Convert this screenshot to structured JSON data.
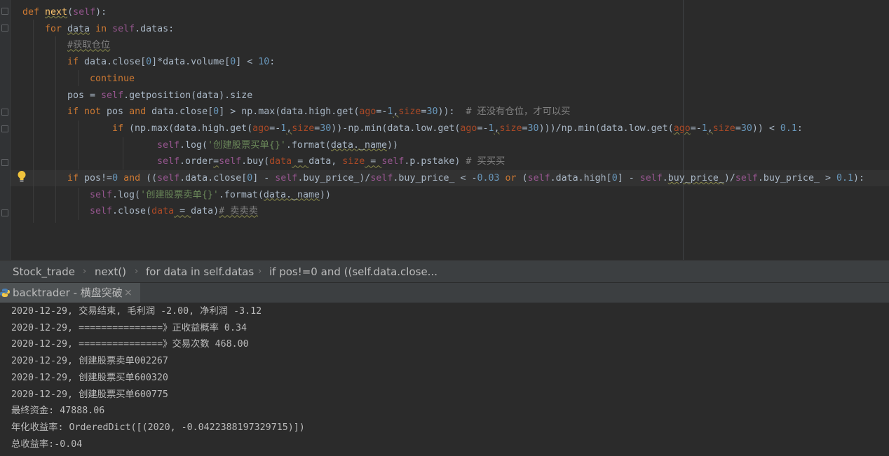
{
  "editor": {
    "lines": [
      {
        "indent": 0,
        "tokens": [
          {
            "t": "def ",
            "c": "kw"
          },
          {
            "t": "next",
            "c": "fn sq"
          },
          {
            "t": "(",
            "c": ""
          },
          {
            "t": "self",
            "c": "slf"
          },
          {
            "t": "):",
            "c": ""
          }
        ]
      },
      {
        "indent": 1,
        "tokens": [
          {
            "t": "for ",
            "c": "kw"
          },
          {
            "t": "data",
            "c": "sq"
          },
          {
            "t": " in ",
            "c": "kw"
          },
          {
            "t": "self",
            "c": "slf"
          },
          {
            "t": ".datas:",
            "c": ""
          }
        ]
      },
      {
        "indent": 2,
        "tokens": [
          {
            "t": "#获取仓位",
            "c": "cmt sq"
          }
        ]
      },
      {
        "indent": 2,
        "tokens": [
          {
            "t": "if ",
            "c": "kw"
          },
          {
            "t": "data.close[",
            "c": ""
          },
          {
            "t": "0",
            "c": "num"
          },
          {
            "t": "]*data.volume[",
            "c": ""
          },
          {
            "t": "0",
            "c": "num"
          },
          {
            "t": "] < ",
            "c": ""
          },
          {
            "t": "10",
            "c": "num"
          },
          {
            "t": ":",
            "c": ""
          }
        ]
      },
      {
        "indent": 3,
        "tokens": [
          {
            "t": "continue",
            "c": "kw"
          }
        ]
      },
      {
        "indent": 2,
        "tokens": [
          {
            "t": "pos = ",
            "c": ""
          },
          {
            "t": "self",
            "c": "slf"
          },
          {
            "t": ".getposition(data).size",
            "c": ""
          }
        ]
      },
      {
        "indent": 2,
        "tokens": [
          {
            "t": "if not ",
            "c": "kw"
          },
          {
            "t": "pos ",
            "c": ""
          },
          {
            "t": "and ",
            "c": "kw"
          },
          {
            "t": "data.close[",
            "c": ""
          },
          {
            "t": "0",
            "c": "num"
          },
          {
            "t": "] > np.max(data.high.get(",
            "c": ""
          },
          {
            "t": "ago",
            "c": "prm"
          },
          {
            "t": "=-",
            "c": ""
          },
          {
            "t": "1",
            "c": "num"
          },
          {
            "t": ",",
            "c": "sq"
          },
          {
            "t": "size",
            "c": "prm"
          },
          {
            "t": "=",
            "c": ""
          },
          {
            "t": "30",
            "c": "num"
          },
          {
            "t": ")):  ",
            "c": ""
          },
          {
            "t": "# 还没有仓位，才可以买",
            "c": "cmt"
          }
        ]
      },
      {
        "indent": 4,
        "tokens": [
          {
            "t": "if ",
            "c": "kw"
          },
          {
            "t": "(np.max(data.high.get(",
            "c": ""
          },
          {
            "t": "ago",
            "c": "prm"
          },
          {
            "t": "=-",
            "c": ""
          },
          {
            "t": "1",
            "c": "num"
          },
          {
            "t": ",",
            "c": "sq"
          },
          {
            "t": "size",
            "c": "prm"
          },
          {
            "t": "=",
            "c": ""
          },
          {
            "t": "30",
            "c": "num"
          },
          {
            "t": "))-np.min(data.low.get(",
            "c": ""
          },
          {
            "t": "ago",
            "c": "prm"
          },
          {
            "t": "=-",
            "c": ""
          },
          {
            "t": "1",
            "c": "num"
          },
          {
            "t": ",",
            "c": "sq"
          },
          {
            "t": "size",
            "c": "prm"
          },
          {
            "t": "=",
            "c": ""
          },
          {
            "t": "30",
            "c": "num"
          },
          {
            "t": ")))/np.min(data.low.get(",
            "c": ""
          },
          {
            "t": "ago",
            "c": "prm sq"
          },
          {
            "t": "=-",
            "c": ""
          },
          {
            "t": "1",
            "c": "num"
          },
          {
            "t": ",",
            "c": "sq"
          },
          {
            "t": "size",
            "c": "prm"
          },
          {
            "t": "=",
            "c": ""
          },
          {
            "t": "30",
            "c": "num"
          },
          {
            "t": ")) < ",
            "c": ""
          },
          {
            "t": "0.1",
            "c": "num"
          },
          {
            "t": ":",
            "c": ""
          }
        ]
      },
      {
        "indent": 6,
        "tokens": [
          {
            "t": "self",
            "c": "slf"
          },
          {
            "t": ".log(",
            "c": ""
          },
          {
            "t": "'创建股票买单{}'",
            "c": "str"
          },
          {
            "t": ".format(",
            "c": ""
          },
          {
            "t": "data._name",
            "c": "sq"
          },
          {
            "t": "))",
            "c": ""
          }
        ]
      },
      {
        "indent": 6,
        "tokens": [
          {
            "t": "self",
            "c": "slf"
          },
          {
            "t": ".order",
            "c": ""
          },
          {
            "t": "=",
            "c": "sq"
          },
          {
            "t": "self",
            "c": "slf"
          },
          {
            "t": ".buy(",
            "c": ""
          },
          {
            "t": "data",
            "c": "prm"
          },
          {
            "t": " = ",
            "c": "sq"
          },
          {
            "t": "data, ",
            "c": ""
          },
          {
            "t": "size",
            "c": "prm"
          },
          {
            "t": " = ",
            "c": "sq"
          },
          {
            "t": "self",
            "c": "slf"
          },
          {
            "t": ".p.pstake) ",
            "c": ""
          },
          {
            "t": "# 买买买",
            "c": "cmt"
          }
        ]
      },
      {
        "indent": 2,
        "tokens": [
          {
            "t": "if ",
            "c": "kw"
          },
          {
            "t": "pos!=",
            "c": ""
          },
          {
            "t": "0 ",
            "c": "num"
          },
          {
            "t": "and ",
            "c": "kw"
          },
          {
            "t": "((",
            "c": ""
          },
          {
            "t": "self",
            "c": "slf"
          },
          {
            "t": ".data.close[",
            "c": ""
          },
          {
            "t": "0",
            "c": "num"
          },
          {
            "t": "] - ",
            "c": ""
          },
          {
            "t": "self",
            "c": "slf"
          },
          {
            "t": ".buy_price_)/",
            "c": ""
          },
          {
            "t": "self",
            "c": "slf"
          },
          {
            "t": ".buy_price_ < -",
            "c": ""
          },
          {
            "t": "0.03 ",
            "c": "num"
          },
          {
            "t": "or ",
            "c": "kw"
          },
          {
            "t": "(",
            "c": ""
          },
          {
            "t": "self",
            "c": "slf"
          },
          {
            "t": ".data.high[",
            "c": ""
          },
          {
            "t": "0",
            "c": "num"
          },
          {
            "t": "] - ",
            "c": ""
          },
          {
            "t": "self",
            "c": "slf"
          },
          {
            "t": ".",
            "c": ""
          },
          {
            "t": "buy_price_",
            "c": "sq"
          },
          {
            "t": ")/",
            "c": ""
          },
          {
            "t": "self",
            "c": "slf"
          },
          {
            "t": ".buy_price_ > ",
            "c": ""
          },
          {
            "t": "0.1",
            "c": "num"
          },
          {
            "t": "):",
            "c": ""
          }
        ]
      },
      {
        "indent": 3,
        "tokens": [
          {
            "t": "self",
            "c": "slf"
          },
          {
            "t": ".log(",
            "c": ""
          },
          {
            "t": "'创建股票卖单{}'",
            "c": "str"
          },
          {
            "t": ".format(",
            "c": ""
          },
          {
            "t": "data._name",
            "c": "sq"
          },
          {
            "t": "))",
            "c": ""
          }
        ]
      },
      {
        "indent": 3,
        "tokens": [
          {
            "t": "self",
            "c": "slf"
          },
          {
            "t": ".close(",
            "c": ""
          },
          {
            "t": "data",
            "c": "prm"
          },
          {
            "t": " = ",
            "c": "sq"
          },
          {
            "t": "data)",
            "c": ""
          },
          {
            "t": "# 卖卖卖",
            "c": "cmt sq"
          }
        ]
      }
    ]
  },
  "breadcrumb": {
    "items": [
      "Stock_trade",
      "next()",
      "for data in self.datas",
      "if pos!=0 and ((self.data.close..."
    ],
    "separator": "›"
  },
  "run_tab": {
    "label": "backtrader - 横盘突破",
    "close": "×"
  },
  "console": {
    "lines": [
      "2020-12-29, 交易结束, 毛利润 -2.00, 净利润 -3.12",
      "2020-12-29, ===============》正收益概率 0.34",
      "2020-12-29, ===============》交易次数 468.00",
      "2020-12-29, 创建股票卖单002267",
      "2020-12-29, 创建股票买单600320",
      "2020-12-29, 创建股票买单600775",
      "最终资金: 47888.06",
      "年化收益率: OrderedDict([(2020, -0.0422388197329715)])",
      "总收益率:-0.04"
    ]
  }
}
